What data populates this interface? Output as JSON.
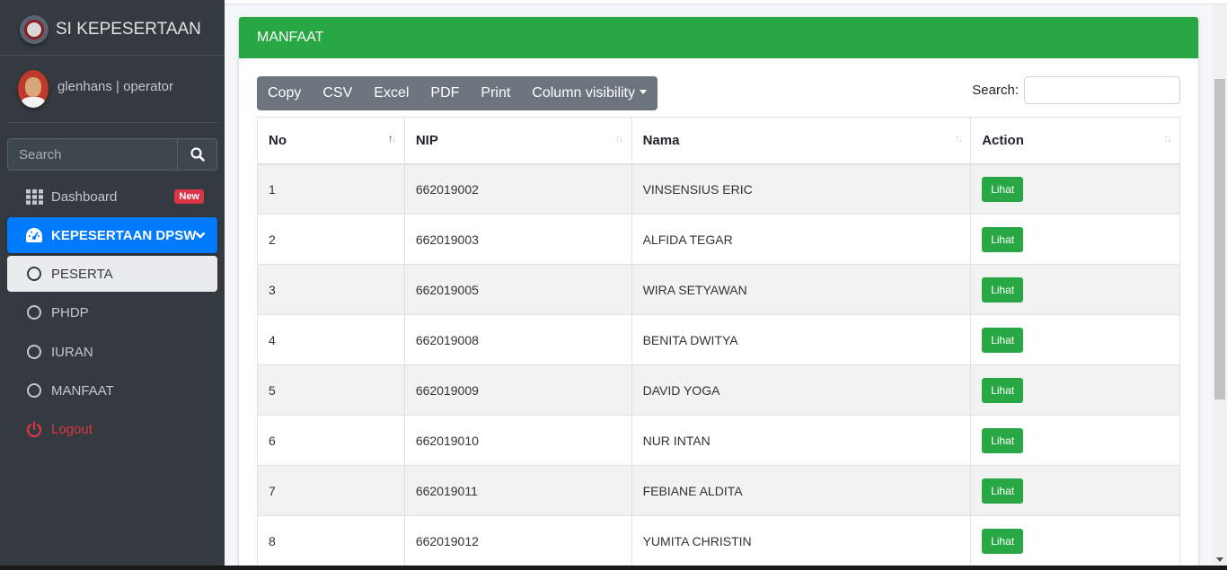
{
  "brand": {
    "title": "SI KEPESERTAAN"
  },
  "user": {
    "name": "glenhans | operator"
  },
  "sidebar": {
    "search_placeholder": "Search",
    "items": [
      {
        "label": "Dashboard",
        "badge": "New"
      },
      {
        "label": "KEPESERTAAN DPSW"
      },
      {
        "label": "PESERTA"
      },
      {
        "label": "PHDP"
      },
      {
        "label": "IURAN"
      },
      {
        "label": "MANFAAT"
      },
      {
        "label": "Logout"
      }
    ]
  },
  "card": {
    "title": "MANFAAT",
    "buttons": [
      "Copy",
      "CSV",
      "Excel",
      "PDF",
      "Print",
      "Column visibility"
    ],
    "search_label": "Search:"
  },
  "table": {
    "headers": [
      "No",
      "NIP",
      "Nama",
      "Action"
    ],
    "action_label": "Lihat",
    "rows": [
      {
        "no": "1",
        "nip": "662019002",
        "nama": "VINSENSIUS ERIC"
      },
      {
        "no": "2",
        "nip": "662019003",
        "nama": "ALFIDA TEGAR"
      },
      {
        "no": "3",
        "nip": "662019005",
        "nama": "WIRA SETYAWAN"
      },
      {
        "no": "4",
        "nip": "662019008",
        "nama": "BENITA DWITYA"
      },
      {
        "no": "5",
        "nip": "662019009",
        "nama": "DAVID YOGA"
      },
      {
        "no": "6",
        "nip": "662019010",
        "nama": "NUR INTAN"
      },
      {
        "no": "7",
        "nip": "662019011",
        "nama": "FEBIANE ALDITA"
      },
      {
        "no": "8",
        "nip": "662019012",
        "nama": "YUMITA CHRISTIN"
      }
    ]
  },
  "colors": {
    "sidebar": "#343a40",
    "primary": "#007bff",
    "success": "#28a745",
    "danger": "#dc3545"
  }
}
